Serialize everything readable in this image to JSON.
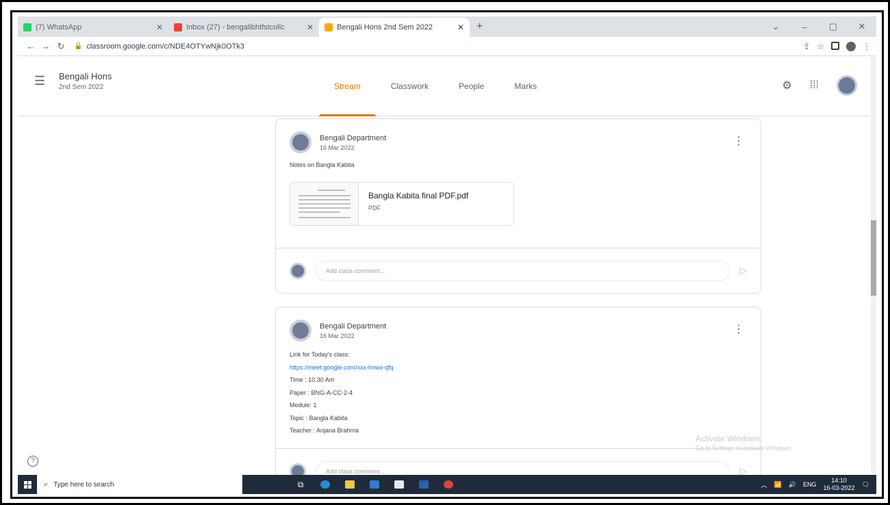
{
  "browser": {
    "tabs": [
      {
        "title": "(7) WhatsApp",
        "fav_color": "#25d366",
        "active": false
      },
      {
        "title": "Inbox (27) - bengalibhtfstcollc",
        "fav_color": "#ea4335",
        "active": false
      },
      {
        "title": "Bengali Hons 2nd Sem 2022",
        "fav_color": "#f9ab00",
        "active": true
      }
    ],
    "new_tab": "+",
    "url": "classroom.google.com/c/NDE4OTYwNjk0OTk3",
    "window_controls": [
      "⌄",
      "–",
      "▢",
      "✕"
    ]
  },
  "classroom": {
    "class_title": "Bengali Hons",
    "class_section": "2nd Sem 2022",
    "nav_tabs": [
      "Stream",
      "Classwork",
      "People",
      "Marks"
    ],
    "active_tab": "Stream",
    "accent": "#e37400"
  },
  "posts": [
    {
      "author": "Bengali Department",
      "date": "16 Mar 2022",
      "text": "Notes on Bangla Kabita",
      "attachment": {
        "name": "Bangla Kabita final PDF.pdf",
        "type": "PDF"
      },
      "comment_placeholder": "Add class comment..."
    },
    {
      "author": "Bengali Department",
      "date": "16 Mar 2022",
      "lines": [
        "Link for Today's class:",
        "https://meet.google.com/xxx-hnwx-qfq",
        "Time : 10.30 Am",
        "Paper : BNG-A-CC-2-4",
        "Module: 1",
        "Topic : Bangla Kabita",
        "Teacher : Anjana Brahma"
      ],
      "comment_placeholder": "Add class comment..."
    }
  ],
  "watermark": {
    "line1": "Activate Windows",
    "line2": "Go to Settings to activate Windows."
  },
  "taskbar": {
    "search_placeholder": "Type here to search",
    "time": "14:10",
    "date": "16-03-2022",
    "tray_text": "ENG"
  }
}
